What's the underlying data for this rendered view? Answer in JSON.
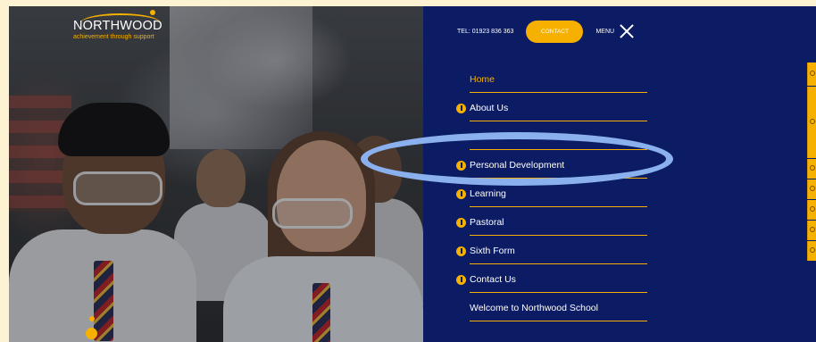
{
  "brand": {
    "name": "NORTHWOOD",
    "tagline": "achievement through support",
    "accent": "#f5b000",
    "navy": "#0b1c64"
  },
  "topbar": {
    "tel": "TEL: 01923 836 363",
    "contact_label": "CONTACT",
    "menu_label": "MENU",
    "close_icon": "close-icon"
  },
  "nav": {
    "items": [
      {
        "label": "Home",
        "active": true,
        "expandable": false
      },
      {
        "label": "About Us",
        "active": false,
        "expandable": true
      },
      {
        "label": "",
        "active": false,
        "expandable": false
      },
      {
        "label": "Personal Development",
        "active": false,
        "expandable": true
      },
      {
        "label": "Learning",
        "active": false,
        "expandable": true
      },
      {
        "label": "Pastoral",
        "active": false,
        "expandable": true
      },
      {
        "label": "Sixth Form",
        "active": false,
        "expandable": true
      },
      {
        "label": "Contact Us",
        "active": false,
        "expandable": true
      },
      {
        "label": "Welcome to Northwood School",
        "active": false,
        "expandable": false
      }
    ]
  },
  "side_tabs": {
    "icons": [
      "clock-icon",
      "calendar-icon",
      "globe-icon",
      "document-icon",
      "pencil-icon",
      "tools-icon",
      "info-icon"
    ]
  }
}
